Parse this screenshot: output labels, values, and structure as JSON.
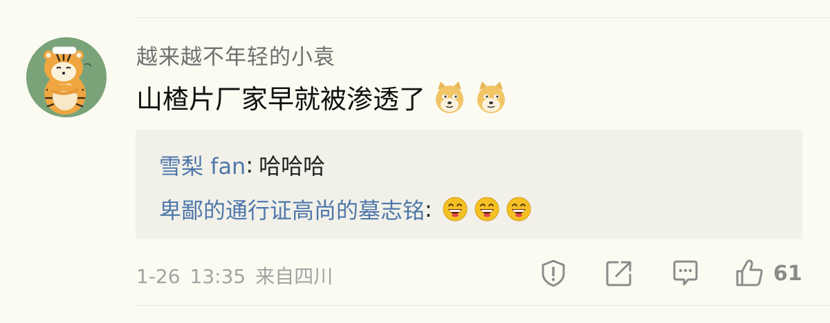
{
  "comment": {
    "username": "越来越不年轻的小袁",
    "text": "山楂片厂家早就被渗透了",
    "emoji_icons": [
      "doge-emoji-icon",
      "doge-emoji-icon"
    ]
  },
  "replies": [
    {
      "author": "雪梨 fan",
      "separator": ":",
      "text": "哈哈哈",
      "emoji_icons": []
    },
    {
      "author": "卑鄙的通行证高尚的墓志铭",
      "separator": ":",
      "text": "",
      "emoji_icons": [
        "laughing-emoji-icon",
        "laughing-emoji-icon",
        "laughing-emoji-icon"
      ]
    }
  ],
  "footer": {
    "date": "1-26",
    "time": "13:35",
    "location": "来自四川",
    "like_count": "61"
  },
  "actions": {
    "icons": [
      "report-icon",
      "share-icon",
      "comment-icon",
      "like-icon"
    ]
  },
  "colors": {
    "background": "#fbfbf2",
    "reply_background": "#f1f1ea",
    "link_blue": "#4f77aa",
    "muted_gray": "#a3a3a3",
    "avatar_green": "#7aa37a"
  }
}
